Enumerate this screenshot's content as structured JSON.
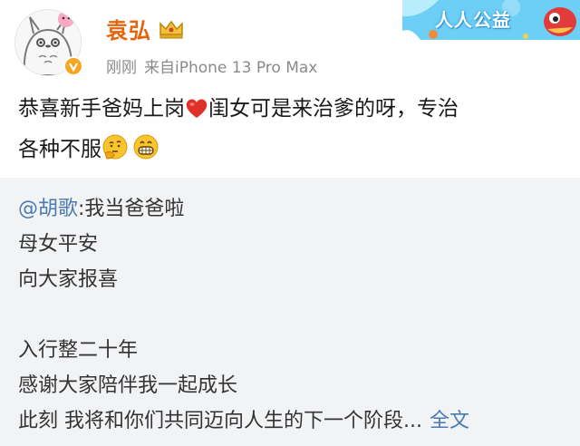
{
  "user": {
    "name": "袁弘",
    "time": "刚刚",
    "source": "来自iPhone 13 Pro Max"
  },
  "banner": {
    "label": "人人公益"
  },
  "post": {
    "line1_a": "恭喜新手爸妈上岗",
    "line1_b": "闺女可是来治爹的呀，专治",
    "line2": "各种不服"
  },
  "repost": {
    "mention": "@胡歌",
    "first_line_rest": ":我当爸爸啦",
    "lines": [
      "母女平安",
      "向大家报喜",
      "入行整二十年",
      "感谢大家陪伴我一起成长"
    ],
    "last_line": "此刻 我将和你们共同迈向人生的下一个阶段...",
    "full_text_link": "全文"
  },
  "colors": {
    "username": "#e8630a",
    "link": "#4a7ab0",
    "repost_bg": "#f2f3f5",
    "meta": "#8a8a8a"
  },
  "icons": [
    "totoro-avatar",
    "verified-badge-icon",
    "crown-icon",
    "heart-icon",
    "thinking-face-icon",
    "grin-face-icon",
    "banner-mascot-icon"
  ]
}
